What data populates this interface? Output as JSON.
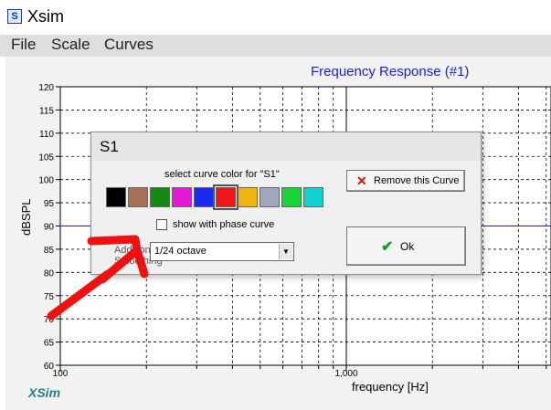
{
  "window": {
    "title": "Xsim",
    "icon": "app-icon-glyph"
  },
  "menu": {
    "items": [
      "File",
      "Scale",
      "Curves"
    ]
  },
  "chart": {
    "title": "Frequency Response (#1)",
    "watermark": "XSim"
  },
  "chart_data": {
    "type": "line",
    "title": "Frequency Response (#1)",
    "xlabel": "frequency [Hz]",
    "ylabel": "dBSPL",
    "xscale": "log",
    "xlim": [
      100,
      10000
    ],
    "ylim": [
      60,
      120
    ],
    "y_ticks": [
      60,
      65,
      70,
      75,
      80,
      85,
      90,
      95,
      100,
      105,
      110,
      115,
      120
    ],
    "x_tick_labels": [
      {
        "value": 100,
        "label": "100"
      },
      {
        "value": 1000,
        "label": "1,000"
      }
    ],
    "grid": true,
    "series": [
      {
        "x": [
          100,
          10000
        ],
        "y": [
          90,
          90
        ],
        "color": "#1a1ae6"
      }
    ]
  },
  "dialog": {
    "title": "S1",
    "color_label": "select curve color for \"S1\"",
    "swatches": [
      "#000000",
      "#a86f55",
      "#128a12",
      "#e21ad6",
      "#1a2aee",
      "#ee1616",
      "#efb40d",
      "#a4a7c0",
      "#18d437",
      "#14cfcf"
    ],
    "selected_swatch": 5,
    "phase_checkbox": {
      "label": "show with phase curve",
      "checked": false
    },
    "smoothing": {
      "label_line1": "Additional",
      "label_line2": "Smoothing",
      "value": "1/24 octave"
    },
    "remove_button": {
      "label": "Remove this Curve",
      "icon": "x-icon"
    },
    "ok_button": {
      "label": "Ok",
      "icon": "checkmark-icon"
    }
  },
  "colors": {
    "curve": "#1a1ae6",
    "annotation_arrow": "#ee1111",
    "chart_title": "#1a1ae6",
    "watermark": "#2a7a8a"
  }
}
